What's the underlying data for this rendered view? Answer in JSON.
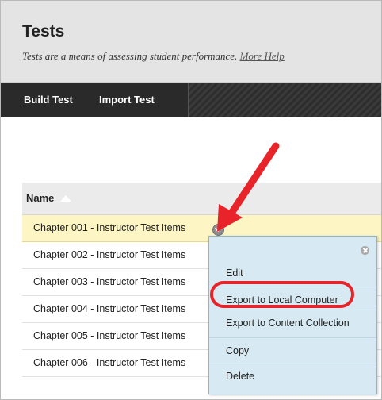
{
  "header": {
    "title": "Tests",
    "subtitle": "Tests are a means of assessing student performance.",
    "more_help": "More Help"
  },
  "actionbar": {
    "build_test": "Build Test",
    "import_test": "Import Test"
  },
  "table": {
    "column_name": "Name",
    "rows": [
      "Chapter 001 - Instructor Test Items",
      "Chapter 002 - Instructor Test Items",
      "Chapter 003 - Instructor Test Items",
      "Chapter 004 - Instructor Test Items",
      "Chapter 005 - Instructor Test Items",
      "Chapter 006 - Instructor Test Items"
    ]
  },
  "context_menu": {
    "items": [
      "Edit",
      "Export to Local Computer",
      "Export to Content Collection",
      "Copy",
      "Delete"
    ]
  },
  "colors": {
    "accent_red": "#e8232a",
    "selected_row": "#fdf5c4",
    "menu_bg": "#d7eaf3"
  }
}
